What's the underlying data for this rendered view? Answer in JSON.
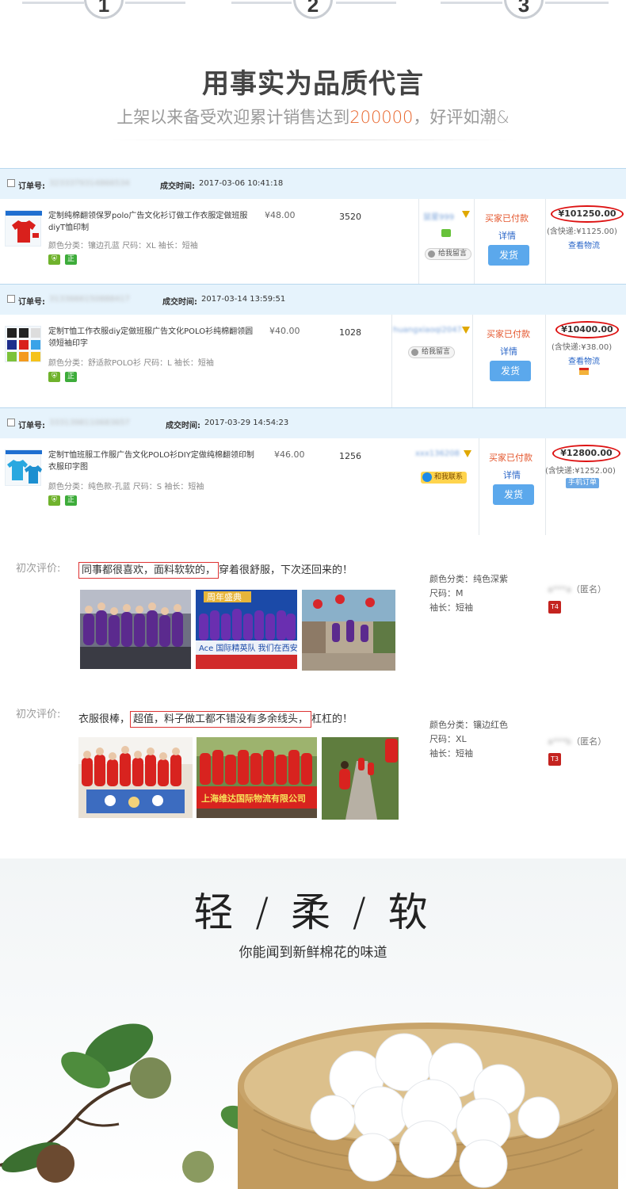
{
  "steps": [
    "1",
    "2",
    "3"
  ],
  "headline": "用事实为品质代言",
  "subline": {
    "before": "上架以来备受欢迎累计销售达到",
    "highlight": "200000",
    "after": "，好评如潮&"
  },
  "colors": {
    "accent": "#e8642a",
    "link": "#2a66c8",
    "ship_button": "#5ba8ec",
    "header_bg": "#e6f3fc"
  },
  "orders": [
    {
      "no_label": "订单号:",
      "no_value": "3233379314866534",
      "time_label": "成交时间:",
      "time_value": "2017-03-06 10:41:18",
      "title": "定制纯棉翻领保罗polo广告文化衫订做工作衣服定做班服diyT恤印制",
      "spec": "颜色分类：镶边孔蓝  尺码：XL  袖长：短袖",
      "unit_price": "¥48.00",
      "quantity": "3520",
      "buyer": "鼠星999",
      "msg_label": "给我留言",
      "contact_label": "",
      "status": "买家已付款",
      "detail": "详情",
      "ship": "发货",
      "total": "¥101250.00",
      "ship_fee": "(含快递:¥1125.00)",
      "logistics": "查看物流",
      "extra": ""
    },
    {
      "no_label": "订单号:",
      "no_value": "3133666150888417",
      "time_label": "成交时间:",
      "time_value": "2017-03-14 13:59:51",
      "title": "定制T恤工作衣服diy定做班服广告文化POLO衫纯棉翻领圆领短袖印字",
      "spec": "颜色分类：舒适款POLO衫  尺码：L  袖长：短袖",
      "unit_price": "¥40.00",
      "quantity": "1028",
      "buyer": "huangxiaoqi2047",
      "msg_label": "给我留言",
      "contact_label": "",
      "status": "买家已付款",
      "detail": "详情",
      "ship": "发货",
      "total": "¥10400.00",
      "ship_fee": "(含快递:¥38.00)",
      "logistics": "查看物流",
      "extra": ""
    },
    {
      "no_label": "订单号:",
      "no_value": "3331398110683657",
      "time_label": "成交时间:",
      "time_value": "2017-03-29 14:54:23",
      "title": "定制T恤班服工作服广告文化POLO衫DIY定做纯棉翻领印制衣服印字图",
      "spec": "颜色分类：纯色款-孔蓝  尺码：S  袖长：短袖",
      "unit_price": "¥46.00",
      "quantity": "1256",
      "buyer": "xxx136208",
      "msg_label": "",
      "contact_label": "和我联系",
      "status": "买家已付款",
      "detail": "详情",
      "ship": "发货",
      "total": "¥12800.00",
      "ship_fee": "(含快递:¥1252.00)",
      "logistics": "",
      "extra": "手机订单"
    }
  ],
  "reviews": [
    {
      "label": "初次评价:",
      "boxed": "同事都很喜欢，面料软软的，",
      "rest": "穿着很舒服，下次还回来的！",
      "lead": "",
      "attrs": [
        "颜色分类：纯色深紫",
        "尺码：M",
        "袖长：短袖"
      ],
      "user": "a***a",
      "anon": "（匿名）",
      "level": "T4",
      "photo_text": [
        "Ace 国际精英队  我们在西安",
        "周年盛典"
      ]
    },
    {
      "label": "初次评价:",
      "lead": "衣服很棒，",
      "boxed": "超值，料子做工都不错没有多余线头，",
      "rest": "杠杠的！",
      "attrs": [
        "颜色分类：镶边红色",
        "尺码：XL",
        "袖长：短袖"
      ],
      "user": "a***b",
      "anon": "（匿名）",
      "level": "T3",
      "photo_text": [
        "上海维达国际物流有限公司"
      ]
    }
  ],
  "banner": {
    "title": "轻 / 柔 / 软",
    "subtitle": "你能闻到新鲜棉花的味道"
  }
}
